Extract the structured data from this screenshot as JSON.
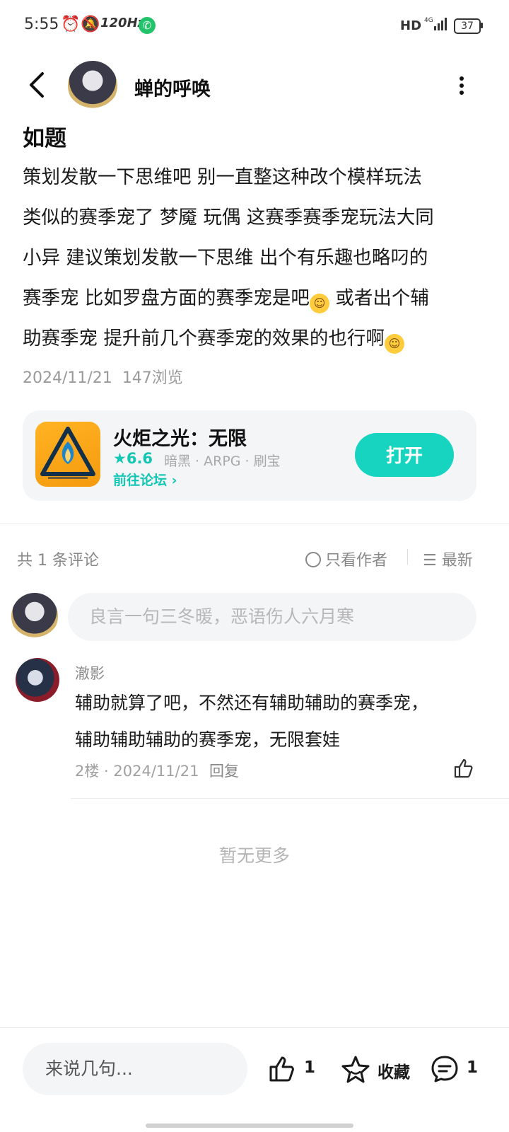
{
  "status_bar": {
    "time": "5:55",
    "refresh_rate": "120Hz",
    "network": "HD",
    "signal": "4G",
    "battery": "37"
  },
  "header": {
    "author_name": "蝉的呼唤"
  },
  "post": {
    "title": "如题",
    "lines": [
      "策划发散一下思维吧 别一直整这种改个模样玩法",
      "类似的赛季宠了 梦魇 玩偶 这赛季赛季宠玩法大同",
      "小异 建议策划发散一下思维 出个有乐趣也略叼的",
      "赛季宠 比如罗盘方面的赛季宠是吧",
      " 或者出个辅",
      "助赛季宠 提升前几个赛季宠的效果的也行啊"
    ],
    "date": "2024/11/21",
    "views": "147浏览"
  },
  "game_card": {
    "name": "火炬之光：无限",
    "rating": "6.6",
    "tags": "暗黑 · ARPG · 刷宝",
    "forum_link": "前往论坛",
    "open_button": "打开",
    "accent_color": "#16d4c0"
  },
  "comments": {
    "count_label": "共 1 条评论",
    "author_only": "只看作者",
    "sort": "最新",
    "input_placeholder": "良言一句三冬暖，恶语伤人六月寒",
    "items": [
      {
        "name": "澈影",
        "text_line1": "辅助就算了吧，不然还有辅助辅助的赛季宠，",
        "text_line2": "辅助辅助辅助的赛季宠，无限套娃",
        "meta": "2楼 · 2024/11/21",
        "reply": "回复"
      }
    ],
    "no_more": "暂无更多"
  },
  "bottom_bar": {
    "input_placeholder": "来说几句...",
    "likes": "1",
    "favorite": "收藏",
    "comments": "1"
  }
}
